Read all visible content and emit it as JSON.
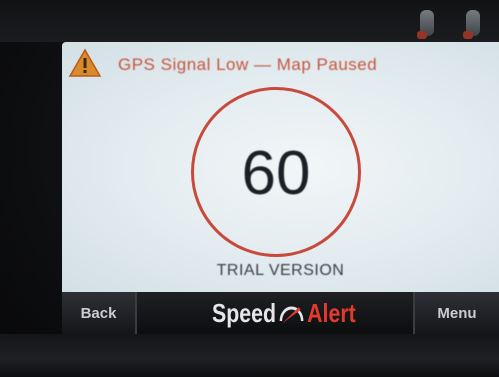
{
  "warning": {
    "icon": "warning-triangle-icon",
    "text": "GPS Signal Low — Map Paused",
    "color": "#c7563f"
  },
  "speed": {
    "value": "60",
    "ring_color": "#c74a3c"
  },
  "trial_label": "TRIAL VERSION",
  "bottom_bar": {
    "back_label": "Back",
    "menu_label": "Menu",
    "logo": {
      "speed_text": "Speed",
      "alert_text": "Alert",
      "icon": "gauge-needle-icon",
      "speed_color": "#e4e6ea",
      "alert_color": "#e23b2b"
    }
  },
  "status_icons": [
    "device-status-icon",
    "device-status-icon"
  ]
}
